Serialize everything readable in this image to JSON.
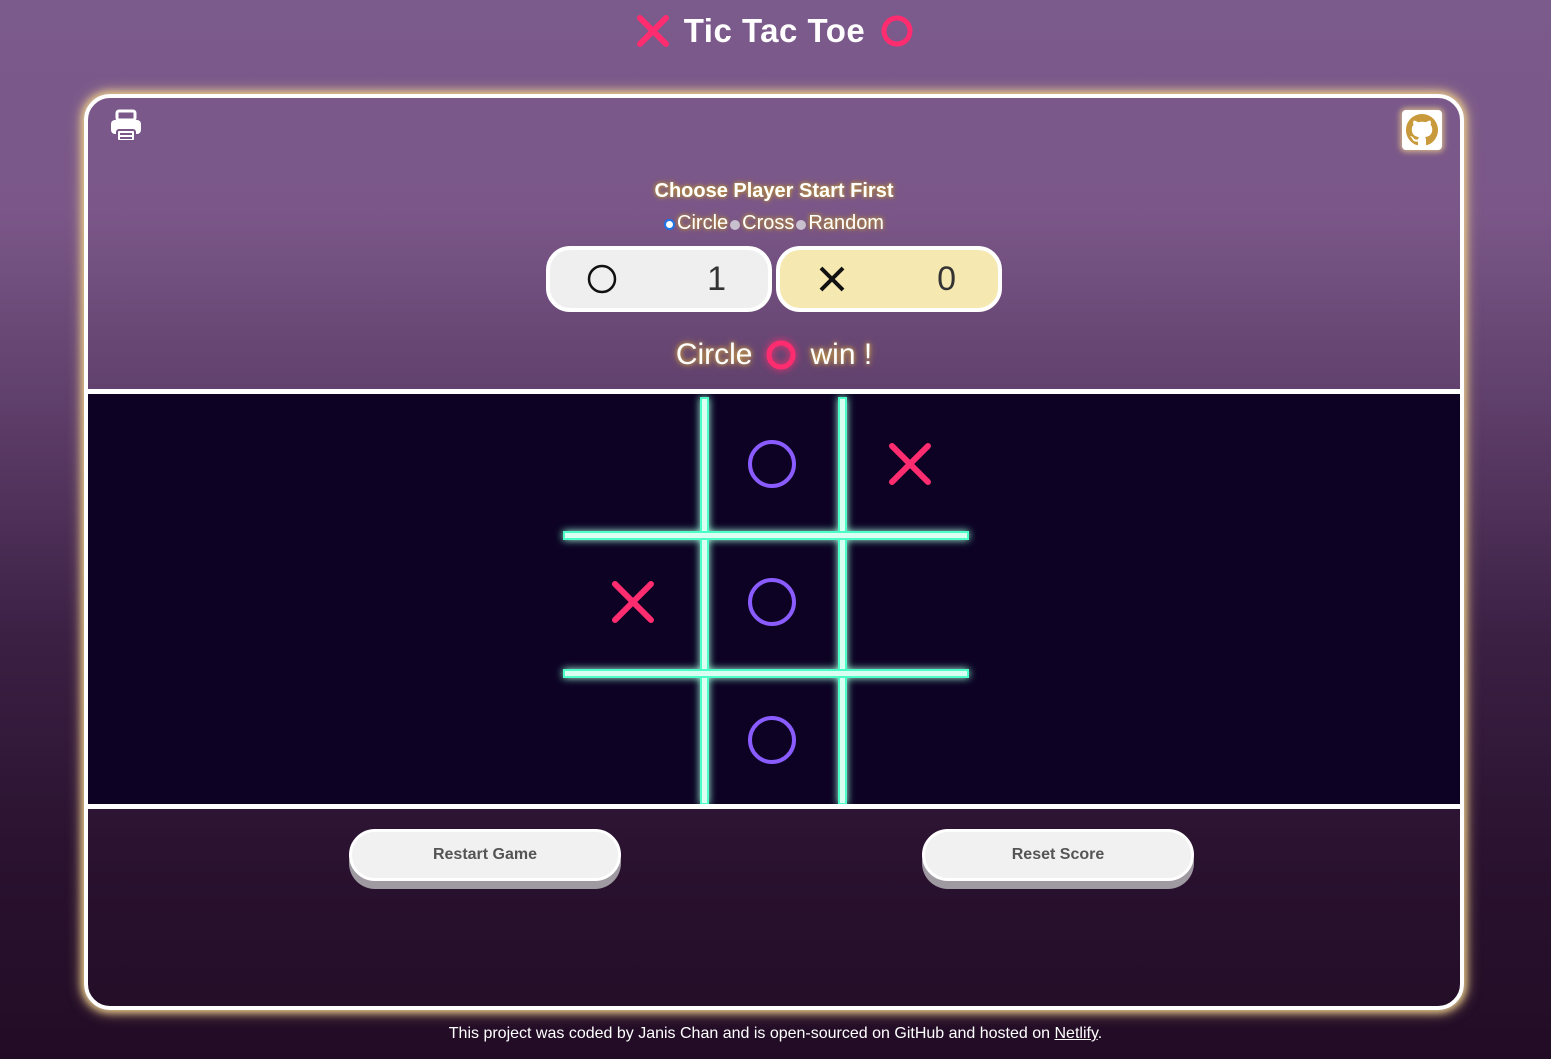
{
  "header": {
    "title": "Tic Tac Toe",
    "left_icon": "cross-icon",
    "right_icon": "circle-icon"
  },
  "toolbar": {
    "print_icon": "print-icon",
    "github_icon": "github-icon"
  },
  "start_choice": {
    "label": "Choose Player Start First",
    "options": [
      "Circle",
      "Cross",
      "Random"
    ],
    "selected": "Circle"
  },
  "scores": {
    "circle": {
      "symbol": "circle",
      "value": "1"
    },
    "cross": {
      "symbol": "cross",
      "value": "0"
    }
  },
  "status": {
    "player": "Circle",
    "suffix": "win !"
  },
  "board": {
    "cells": [
      "",
      "O",
      "X",
      "X",
      "O",
      "",
      "",
      "O",
      ""
    ]
  },
  "buttons": {
    "restart_label": "Restart Game",
    "reset_label": "Reset Score"
  },
  "footer": {
    "text": "This project was coded by Janis Chan and is open-sourced on GitHub and hosted on ",
    "link": "Netlify",
    "end": "."
  },
  "colors": {
    "grid": "#7fffd4",
    "circle_mark": "#8a5cff",
    "cross_mark": "#ff2d6f",
    "accent_glow": "#e7c98a"
  }
}
